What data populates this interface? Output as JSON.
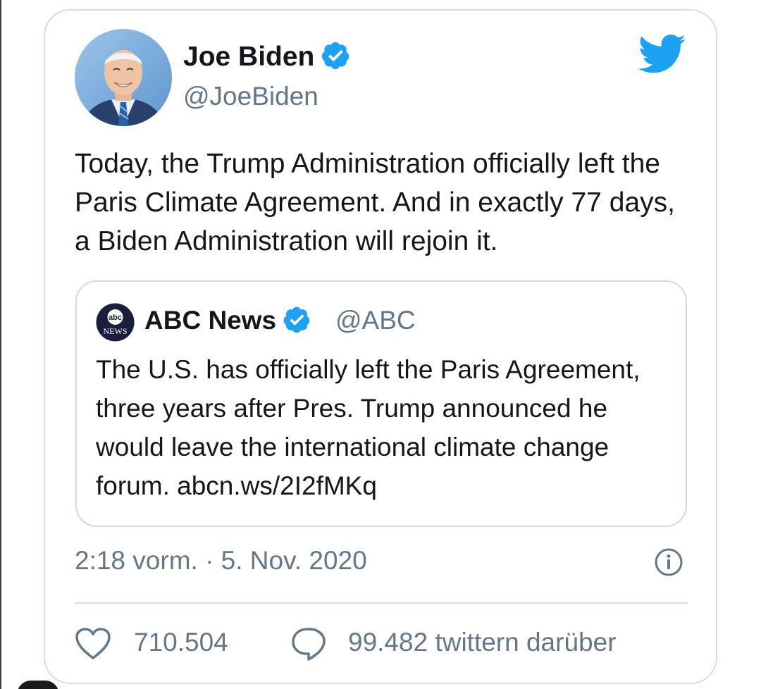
{
  "author": {
    "name": "Joe Biden",
    "handle": "@JoeBiden",
    "verified": true
  },
  "tweet": {
    "text": "Today, the Trump Administration officially left the Paris Climate Agreement. And in exactly 77 days, a Biden Administration will rejoin it."
  },
  "quoted_tweet": {
    "logo_text_top": "abc",
    "logo_text_bottom": "NEWS",
    "name": "ABC News",
    "handle": "@ABC",
    "verified": true,
    "text": "The U.S. has officially left the Paris Agreement, three years after Pres. Trump announced he would leave the international climate change forum. abcn.ws/2I2fMKq"
  },
  "meta": {
    "timestamp": "2:18 vorm. · 5. Nov. 2020"
  },
  "actions": {
    "likes": "710.504",
    "replies": "99.482 twittern darüber"
  },
  "icons": {
    "brand": "twitter-bird-icon",
    "verified": "verified-badge-icon",
    "info": "info-icon",
    "like": "heart-icon",
    "reply": "speech-bubble-icon"
  },
  "colors": {
    "twitter_blue": "#1da1f2",
    "text_primary": "#14171a",
    "text_secondary": "#657786",
    "border": "#d7dde2"
  }
}
